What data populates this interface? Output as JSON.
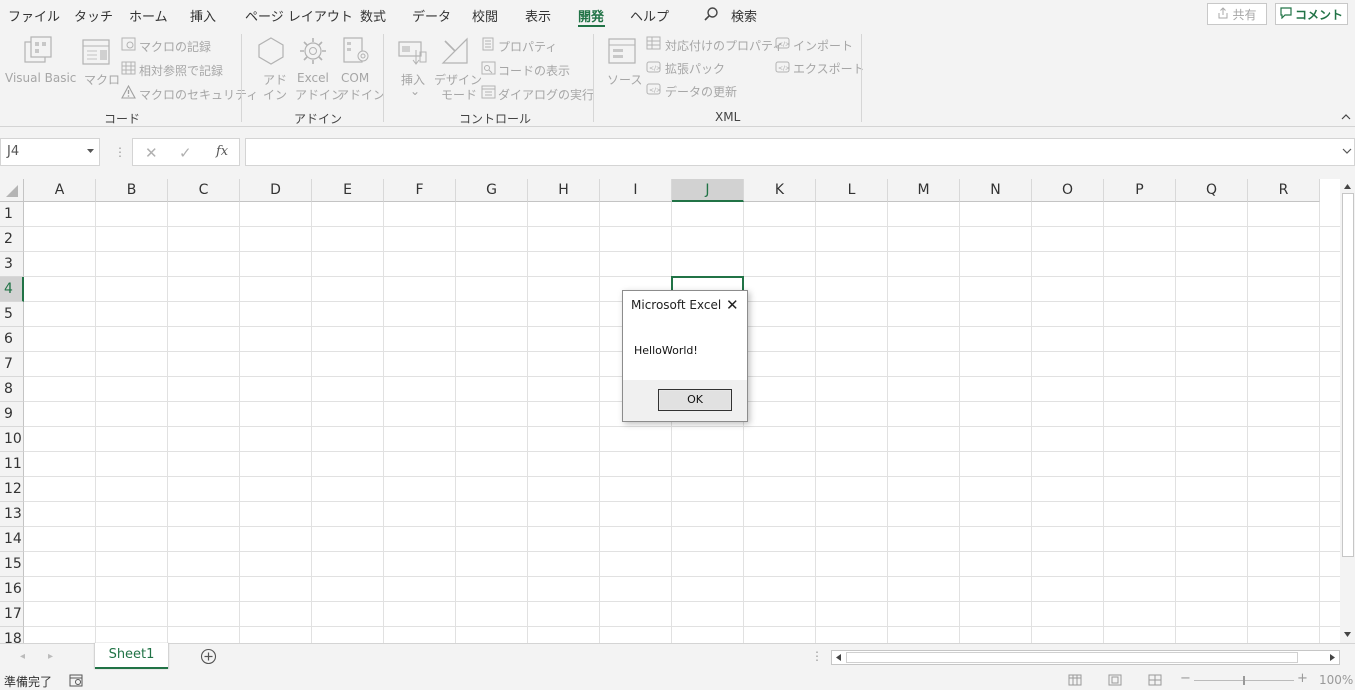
{
  "menu": {
    "items": [
      "ファイル",
      "タッチ",
      "ホーム",
      "挿入",
      "ページ レイアウト",
      "数式",
      "データ",
      "校閲",
      "表示",
      "開発",
      "ヘルプ"
    ],
    "active": "開発",
    "search_label": "検索",
    "share_label": "共有",
    "comment_label": "コメント"
  },
  "ribbon": {
    "code": {
      "label": "コード",
      "visual_basic": "Visual Basic",
      "macro": "マクロ",
      "record_macro": "マクロの記録",
      "relative_ref": "相対参照で記録",
      "macro_security": "マクロのセキュリティ"
    },
    "addin": {
      "label": "アドイン",
      "addin_l1": "アド",
      "addin_l2": "イン",
      "excel_l1": "Excel",
      "excel_l2": "アドイン",
      "com_l1": "COM",
      "com_l2": "アドイン"
    },
    "controls": {
      "label": "コントロール",
      "insert": "挿入",
      "design_l1": "デザイン",
      "design_l2": "モード",
      "properties": "プロパティ",
      "view_code": "コードの表示",
      "run_dialog": "ダイアログの実行"
    },
    "xml": {
      "label": "XML",
      "source": "ソース",
      "map_props": "対応付けのプロパティ",
      "expansion": "拡張パック",
      "refresh": "データの更新",
      "import": "インポート",
      "export": "エクスポート"
    }
  },
  "formula_bar": {
    "name_box": "J4",
    "fx": "fx",
    "value": ""
  },
  "grid": {
    "columns": [
      "A",
      "B",
      "C",
      "D",
      "E",
      "F",
      "G",
      "H",
      "I",
      "J",
      "K",
      "L",
      "M",
      "N",
      "O",
      "P",
      "Q",
      "R"
    ],
    "rows": [
      "1",
      "2",
      "3",
      "4",
      "5",
      "6",
      "7",
      "8",
      "9",
      "10",
      "11",
      "12",
      "13",
      "14",
      "15",
      "16",
      "17",
      "18"
    ],
    "selected_column": "J",
    "selected_row": "4"
  },
  "sheets": {
    "tabs": [
      "Sheet1"
    ],
    "add_label": "+"
  },
  "status": {
    "text": "準備完了",
    "zoom": "100%"
  },
  "dialog": {
    "title": "Microsoft Excel",
    "message": "HelloWorld!",
    "ok_label": "OK"
  },
  "colors": {
    "accent": "#217346"
  }
}
